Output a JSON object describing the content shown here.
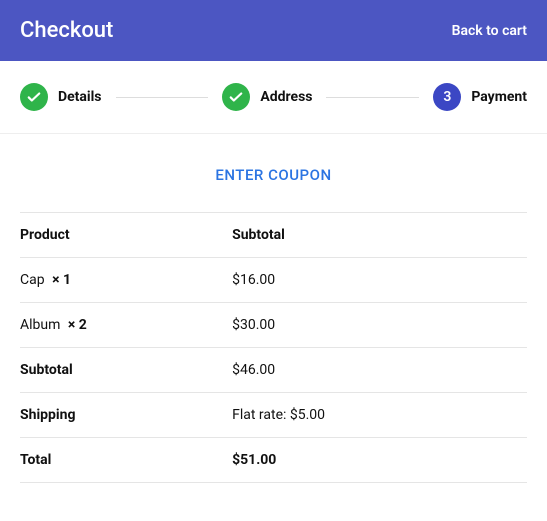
{
  "header": {
    "title": "Checkout",
    "back": "Back to cart"
  },
  "steps": {
    "s1": {
      "label": "Details"
    },
    "s2": {
      "label": "Address"
    },
    "s3": {
      "num": "3",
      "label": "Payment"
    }
  },
  "coupon_label": "ENTER COUPON",
  "table": {
    "head_product": "Product",
    "head_subtotal": "Subtotal",
    "items": [
      {
        "name": "Cap",
        "qty": "× 1",
        "price": "$16.00"
      },
      {
        "name": "Album",
        "qty": "× 2",
        "price": "$30.00"
      }
    ],
    "subtotal_label": "Subtotal",
    "subtotal_value": "$46.00",
    "shipping_label": "Shipping",
    "shipping_value": "Flat rate: $5.00",
    "total_label": "Total",
    "total_value": "$51.00"
  }
}
